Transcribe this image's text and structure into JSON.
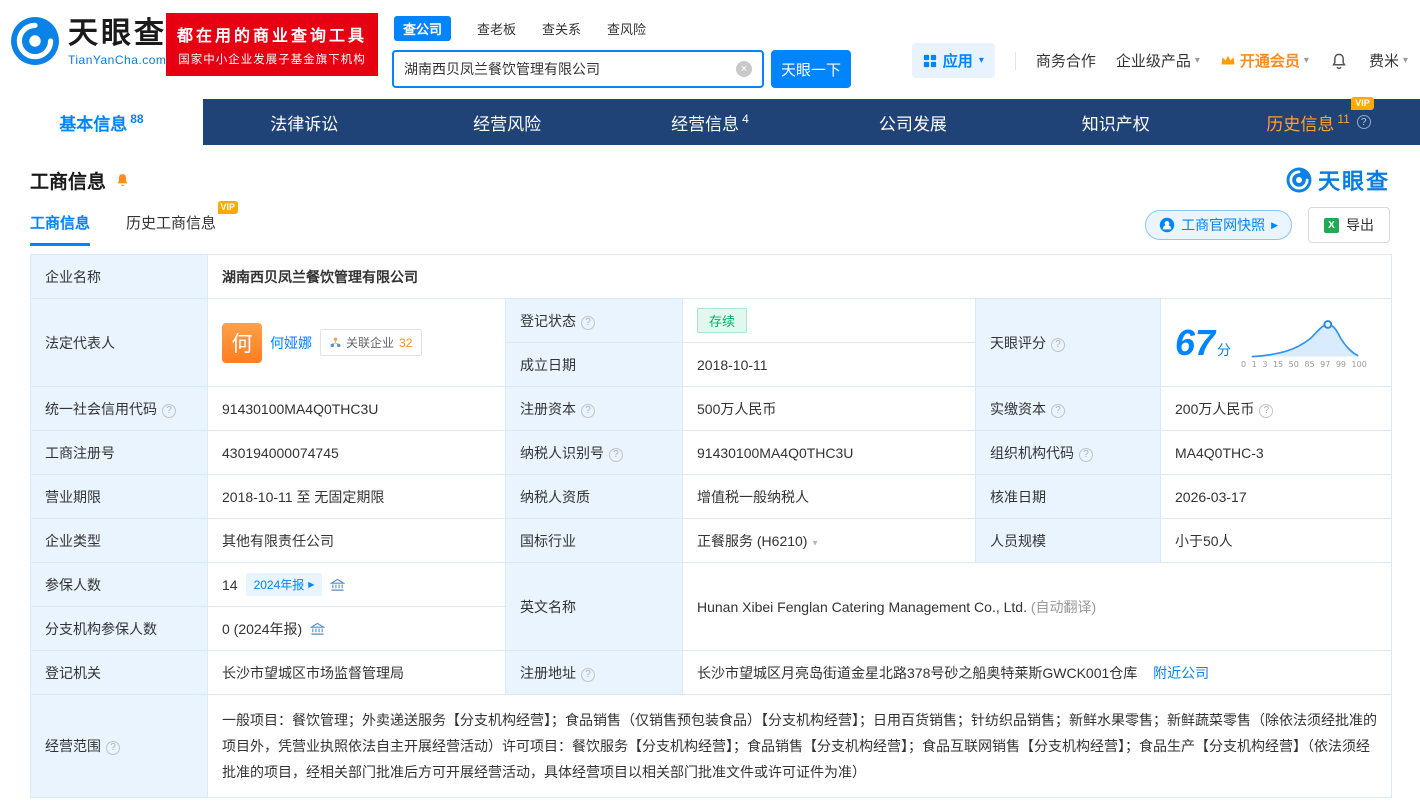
{
  "brand": {
    "name": "天眼查",
    "domain": "TianYanCha.com",
    "slogan_line1": "都在用的商业查询工具",
    "slogan_line2": "国家中小企业发展子基金旗下机构"
  },
  "search": {
    "tabs": [
      {
        "label": "查公司"
      },
      {
        "label": "查老板"
      },
      {
        "label": "查关系"
      },
      {
        "label": "查风险"
      }
    ],
    "value": "湖南西贝凤兰餐饮管理有限公司",
    "button": "天眼一下"
  },
  "top_menu": {
    "apps": "应用",
    "cooperation": "商务合作",
    "enterprise": "企业级产品",
    "vip": "开通会员",
    "user": "费米"
  },
  "nav": {
    "tabs": [
      {
        "label": "基本信息",
        "count": "88"
      },
      {
        "label": "法律诉讼"
      },
      {
        "label": "经营风险"
      },
      {
        "label": "经营信息",
        "count": "4"
      },
      {
        "label": "公司发展"
      },
      {
        "label": "知识产权"
      },
      {
        "label": "历史信息",
        "count": "11",
        "vip": "VIP"
      }
    ]
  },
  "section": {
    "title": "工商信息",
    "brand": "天眼查",
    "subtabs": [
      {
        "label": "工商信息"
      },
      {
        "label": "历史工商信息",
        "vip": "VIP"
      }
    ],
    "snapshot_button": "工商官网快照",
    "export_button": "导出"
  },
  "table": {
    "labels": {
      "company_name": "企业名称",
      "legal_rep": "法定代表人",
      "reg_status": "登记状态",
      "establish_date": "成立日期",
      "score": "天眼评分",
      "credit_code": "统一社会信用代码",
      "reg_capital": "注册资本",
      "paid_capital": "实缴资本",
      "reg_number": "工商注册号",
      "taxpayer_id": "纳税人识别号",
      "org_code": "组织机构代码",
      "business_term": "营业期限",
      "taxpayer_quality": "纳税人资质",
      "approve_date": "核准日期",
      "company_type": "企业类型",
      "industry": "国标行业",
      "staff_size": "人员规模",
      "insured_count": "参保人数",
      "english_name": "英文名称",
      "branch_insured": "分支机构参保人数",
      "reg_authority": "登记机关",
      "reg_address": "注册地址",
      "business_scope": "经营范围"
    },
    "values": {
      "company_name": "湖南西贝凤兰餐饮管理有限公司",
      "legal_rep_avatar": "何",
      "legal_rep_name": "何娅娜",
      "related_companies_label": "关联企业",
      "related_companies_count": "32",
      "reg_status": "存续",
      "establish_date": "2018-10-11",
      "score_value": "67",
      "score_unit": "分",
      "score_axis": "0 1 3 15 50 85 97 99 100",
      "credit_code": "91430100MA4Q0THC3U",
      "reg_capital": "500万人民币",
      "paid_capital": "200万人民币",
      "reg_number": "430194000074745",
      "taxpayer_id": "91430100MA4Q0THC3U",
      "org_code": "MA4Q0THC-3",
      "business_term": "2018-10-11 至 无固定期限",
      "taxpayer_quality": "增值税一般纳税人",
      "approve_date": "2026-03-17",
      "company_type": "其他有限责任公司",
      "industry": "正餐服务 (H6210)",
      "staff_size": "小于50人",
      "insured_count": "14",
      "insured_year_tag": "2024年报",
      "english_name": "Hunan Xibei Fenglan Catering Management Co., Ltd.",
      "english_name_note": "(自动翻译)",
      "branch_insured": "0 (2024年报)",
      "reg_authority": "长沙市望城区市场监督管理局",
      "reg_address": "长沙市望城区月亮岛街道金星北路378号砂之船奥特莱斯GWCK001仓库",
      "nearby_link": "附近公司",
      "business_scope": "一般项目：餐饮管理；外卖递送服务【分支机构经营】；食品销售（仅销售预包装食品）【分支机构经营】；日用百货销售；针纺织品销售；新鲜水果零售；新鲜蔬菜零售（除依法须经批准的项目外，凭营业执照依法自主开展经营活动）许可项目：餐饮服务【分支机构经营】；食品销售【分支机构经营】；食品互联网销售【分支机构经营】；食品生产【分支机构经营】（依法须经批准的项目，经相关部门批准后方可开展经营活动，具体经营项目以相关部门批准文件或许可证件为准）"
    }
  },
  "icons": {
    "clear": "×",
    "caret_down": "▾",
    "arrow_right": "▶",
    "help": "?",
    "excel": "X"
  },
  "colors": {
    "primary_blue": "#0084ff",
    "brand_red": "#e60012",
    "nav_navy": "#1f4277",
    "vip_orange": "#ffaa00",
    "status_green": "#00b365"
  }
}
